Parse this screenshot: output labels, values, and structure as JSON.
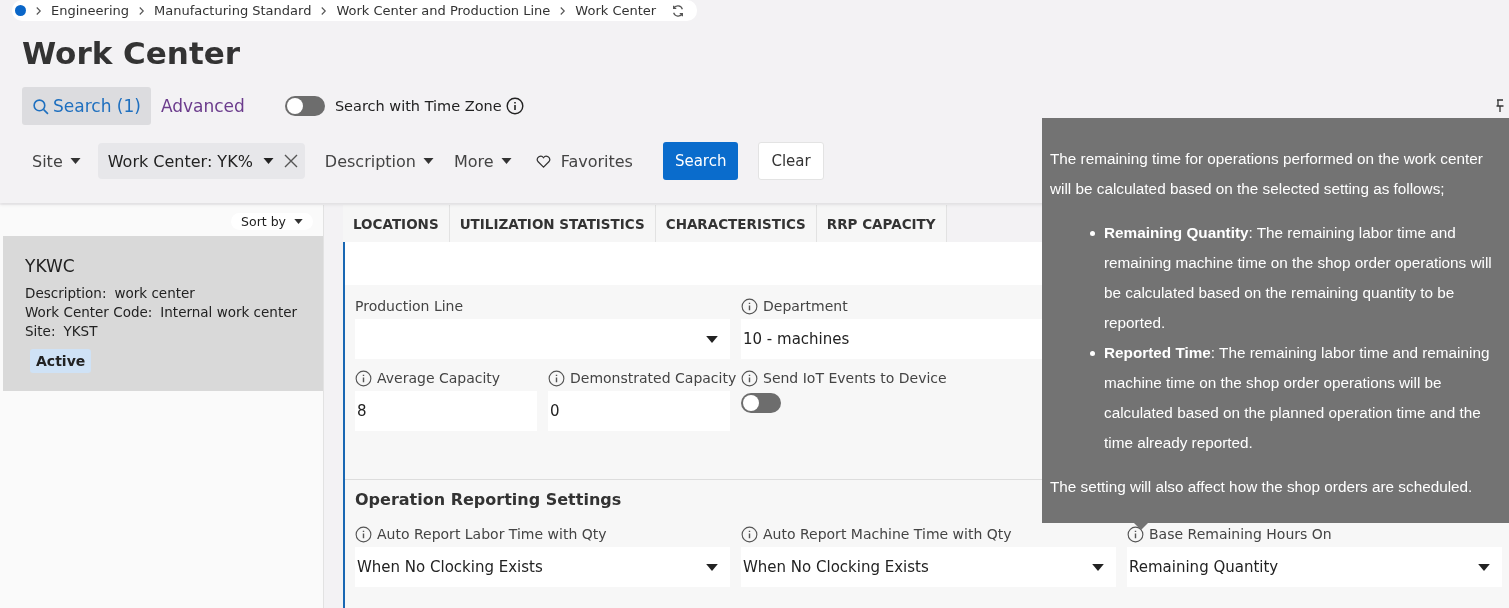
{
  "breadcrumb": [
    "Engineering",
    "Manufacturing Standard",
    "Work Center and Production Line",
    "Work Center"
  ],
  "title": "Work Center",
  "search_tabs": [
    {
      "label": "Search (1)",
      "selected": true
    },
    {
      "label": "Advanced",
      "selected": false
    }
  ],
  "time_zone_toggle": {
    "label": "Search with Time Zone",
    "on": false
  },
  "filters": [
    {
      "label": "Site",
      "kind": "dropdown"
    },
    {
      "label": "Work Center: YK%",
      "kind": "chip"
    },
    {
      "label": "Description",
      "kind": "dropdown"
    },
    {
      "label": "More",
      "kind": "dropdown"
    },
    {
      "label": "Favorites",
      "kind": "favorites"
    }
  ],
  "buttons": [
    {
      "label": "Search",
      "kind": "primary"
    },
    {
      "label": "Clear",
      "kind": "secondary"
    }
  ],
  "list": {
    "sort_label": "Sort by",
    "items": [
      {
        "title": "YKWC",
        "selected": true,
        "fields": [
          {
            "label": "Description:",
            "value": "work center"
          },
          {
            "label": "Work Center Code:",
            "value": "Internal work center"
          },
          {
            "label": "Site:",
            "value": "YKST"
          }
        ],
        "status": "Active"
      }
    ]
  },
  "tabs": [
    {
      "label": "LOCATIONS",
      "selected": false
    },
    {
      "label": "UTILIZATION STATISTICS",
      "selected": false
    },
    {
      "label": "CHARACTERISTICS",
      "selected": false
    },
    {
      "label": "RRP CAPACITY",
      "selected": false
    }
  ],
  "field_rows": [
    [
      {
        "label": "Production Line",
        "info": false,
        "kind": "select"
      },
      {
        "label": "Department",
        "info": true,
        "kind": "select",
        "value": "10 - machines"
      }
    ],
    [
      {
        "label": "Average Capacity",
        "info": true,
        "kind": "text",
        "value": "8"
      },
      {
        "label": "Demonstrated Capacity",
        "info": true,
        "kind": "text",
        "value": "0"
      },
      {
        "label": "Send IoT Events to Device",
        "info": true,
        "kind": "toggle",
        "on": false
      }
    ]
  ],
  "section": {
    "title": "Operation Reporting Settings",
    "fields": [
      {
        "label": "Auto Report Labor Time with Qty",
        "info": true,
        "value": "When No Clocking Exists"
      },
      {
        "label": "Auto Report Machine Time with Qty",
        "info": true,
        "value": "When No Clocking Exists"
      },
      {
        "label": "Base Remaining Hours On",
        "info": true,
        "value": "Remaining Quantity"
      }
    ]
  },
  "tooltip": {
    "intro": "The remaining time for operations performed on the work center will be calculated based on the selected setting as follows;",
    "bullets": [
      "**Remaining Quantity**: The remaining labor time and remaining machine time on the shop order operations will be calculated based on the remaining quantity to be reported.",
      "**Reported Time**: The remaining labor time and remaining machine time on the shop order operations will be calculated based on the planned operation time and the time already reported."
    ],
    "outro": "The setting will also affect how the shop orders are scheduled."
  }
}
